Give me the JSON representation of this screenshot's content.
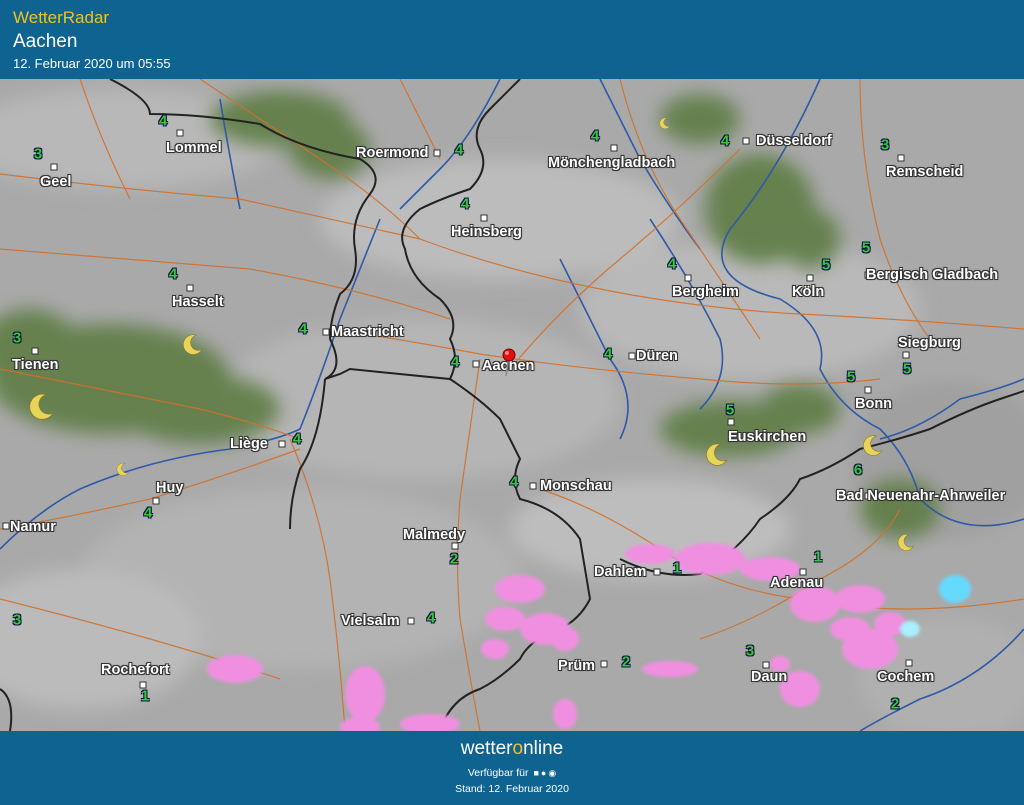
{
  "header": {
    "brand": "WetterRadar",
    "location": "Aachen",
    "datetime": "12. Februar 2020 um 05:55"
  },
  "footer": {
    "logo_pre": "wetter",
    "logo_o": "o",
    "logo_post": "nline",
    "available": "Verfügbar für",
    "os_icons": [
      "android-icon",
      "apple-icon",
      "windows-icon"
    ],
    "stand": "Stand: 12. Februar 2020"
  },
  "colors": {
    "header_bg": "#0f6390",
    "brand": "#f3c21b",
    "map_bg": "#a9a9a9",
    "cloud_green": "#5f7d45",
    "rain_pink": "#f08fe0",
    "snow_cyan": "#66d9ff",
    "border_line": "#222222",
    "road_orange": "#d2702a",
    "river_blue": "#2f5aa8",
    "number_green": "#37c837",
    "moon_yellow": "#e8d45a"
  },
  "cities": [
    {
      "name": "Lommel"
    },
    {
      "name": "Geel"
    },
    {
      "name": "Roermond"
    },
    {
      "name": "Mönchengladbach"
    },
    {
      "name": "Düsseldorf"
    },
    {
      "name": "Remscheid"
    },
    {
      "name": "Heinsberg"
    },
    {
      "name": "Hasselt"
    },
    {
      "name": "Bergheim"
    },
    {
      "name": "Köln"
    },
    {
      "name": "Bergisch Gladbach"
    },
    {
      "name": "Maastricht"
    },
    {
      "name": "Tienen"
    },
    {
      "name": "Aachen"
    },
    {
      "name": "Düren"
    },
    {
      "name": "Siegburg"
    },
    {
      "name": "Bonn"
    },
    {
      "name": "Liège"
    },
    {
      "name": "Euskirchen"
    },
    {
      "name": "Huy"
    },
    {
      "name": "Monschau"
    },
    {
      "name": "Bad Neuenahr-Ahrweiler"
    },
    {
      "name": "Namur"
    },
    {
      "name": "Malmedy"
    },
    {
      "name": "Dahlem"
    },
    {
      "name": "Adenau"
    },
    {
      "name": "Vielsalm"
    },
    {
      "name": "Prüm"
    },
    {
      "name": "Rochefort"
    },
    {
      "name": "Daun"
    },
    {
      "name": "Cochem"
    }
  ],
  "temperatures": [
    "4",
    "3",
    "4",
    "4",
    "4",
    "3",
    "4",
    "4",
    "4",
    "5",
    "5",
    "5",
    "5",
    "3",
    "4",
    "4",
    "4",
    "4",
    "5",
    "4",
    "4",
    "6",
    "3",
    "1",
    "2",
    "1",
    "4",
    "2",
    "1",
    "3",
    "2",
    "5"
  ],
  "moon_icon": "moon-icon",
  "pin_icon": "location-pin-icon"
}
